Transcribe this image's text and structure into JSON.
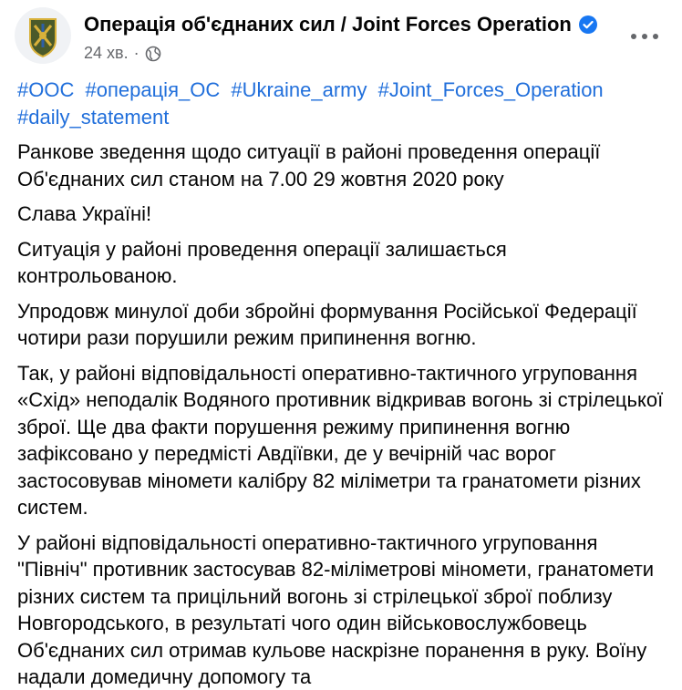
{
  "post": {
    "page_name": "Операція об'єднаних сил / Joint Forces Operation",
    "time": "24 хв.",
    "separator": "·",
    "hashtags": [
      "#ООС",
      "#операція_ОС",
      "#Ukraine_army",
      "#Joint_Forces_Operation",
      "#daily_statement"
    ],
    "paragraphs": [
      "Ранкове зведення щодо ситуації в районі проведення операції Об'єднаних сил станом на 7.00 29 жовтня 2020 року",
      "Слава Україні!",
      "Ситуація у районі проведення операції залишається контрольованою.",
      "Упродовж минулої доби збройні формування Російської Федерації чотири рази порушили режим припинення вогню.",
      "Так, у районі відповідальності оперативно-тактичного угруповання «Схід» неподалік Водяного противник відкривав вогонь зі стрілецької зброї. Ще два факти порушення режиму припинення вогню зафіксовано у передмісті Авдіївки, де у вечірній час ворог застосовував міномети калібру 82 міліметри та гранатомети різних систем.",
      "У районі відповідальності оперативно-тактичного угруповання \"Північ\" противник застосував 82-міліметрові міномети, гранатомети різних систем та прицільний вогонь зі стрілецької зброї поблизу Новгородського, в результаті чого один військовослужбовець Об'єднаних сил отримав кульове наскрізне поранення в руку. Воїну надали домедичну допомогу та"
    ]
  },
  "colors": {
    "link": "#216fdb",
    "text": "#050505",
    "meta": "#65676b",
    "verified": "#1877f2",
    "avatar_olive": "#4a5a2a",
    "avatar_gold": "#d8b13a",
    "avatar_blue": "#2d5fa8"
  },
  "icons": {
    "verified": "verified-badge-icon",
    "audience": "globe-icon",
    "more": "more-options-icon"
  }
}
